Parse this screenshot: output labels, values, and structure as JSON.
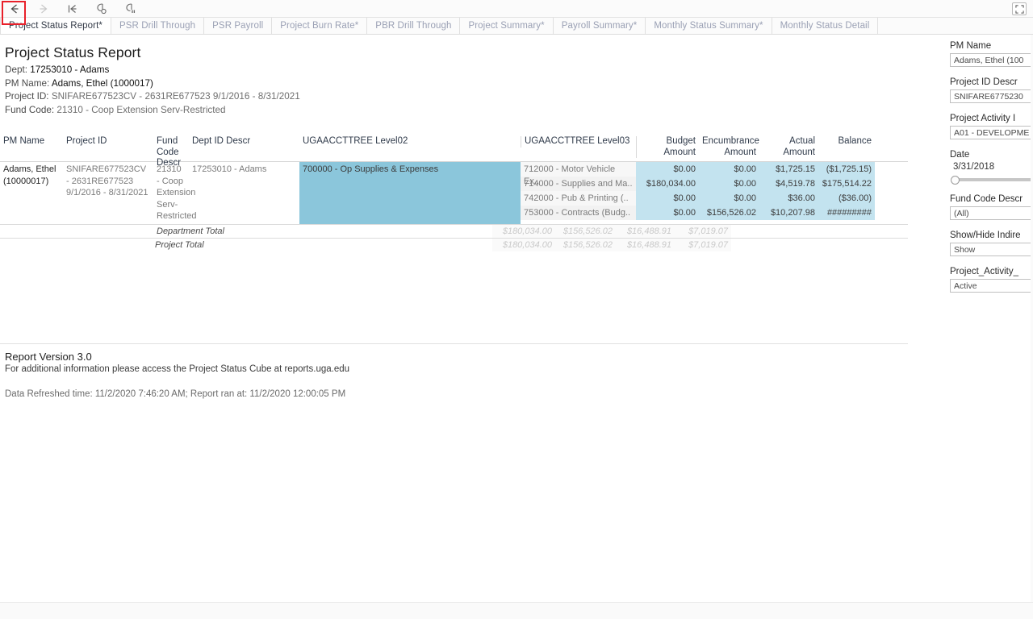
{
  "toolbar": {
    "back": "back-arrow",
    "forward": "forward-arrow",
    "revert": "revert-to-start",
    "refresh": "refresh-data",
    "pause": "pause-auto-updates",
    "fullscreen": "fullscreen-toggle"
  },
  "tabs": [
    {
      "label": "Project Status Report*",
      "active": true
    },
    {
      "label": "PSR Drill Through",
      "active": false
    },
    {
      "label": "PSR Payroll",
      "active": false
    },
    {
      "label": "Project Burn Rate*",
      "active": false
    },
    {
      "label": "PBR Drill Through",
      "active": false
    },
    {
      "label": "Project Summary*",
      "active": false
    },
    {
      "label": "Payroll Summary*",
      "active": false
    },
    {
      "label": "Monthly Status Summary*",
      "active": false
    },
    {
      "label": "Monthly Status Detail",
      "active": false
    }
  ],
  "report": {
    "title": "Project Status Report",
    "dept_label": "Dept:",
    "dept_value": "17253010 - Adams",
    "pm_label": "PM Name:",
    "pm_value": "Adams, Ethel (1000017)",
    "project_label": "Project ID:",
    "project_value": "SNIFARE677523CV - 2631RE677523 9/1/2016 - 8/31/2021",
    "fund_label": "Fund Code:",
    "fund_value": "21310 - Coop Extension Serv-Restricted"
  },
  "table": {
    "headers": {
      "pm_name": "PM Name",
      "project_id": "Project ID",
      "fund_code_descr": "Fund Code Descr",
      "dept_id_descr": "Dept ID Descr",
      "level02": "UGAACCTTREE Level02",
      "level03": "UGAACCTTREE Level03",
      "budget": "Budget Amount",
      "encumbrance": "Encumbrance Amount",
      "actual": "Actual Amount",
      "balance": "Balance"
    },
    "row": {
      "pm_name": "Adams, Ethel (10000017)",
      "project_id": "SNIFARE677523CV - 2631RE677523 9/1/2016 - 8/31/2021",
      "fund_code_descr": "21310 - Coop Extension Serv-Restricted",
      "dept_id_descr": "17253010 - Adams",
      "level02": "700000 - Op Supplies & Expenses"
    },
    "lines": [
      {
        "level03": "712000 - Motor Vehicle Ex..",
        "budget": "$0.00",
        "encumbrance": "$0.00",
        "actual": "$1,725.15",
        "balance": "($1,725.15)"
      },
      {
        "level03": "714000 - Supplies and Ma..",
        "budget": "$180,034.00",
        "encumbrance": "$0.00",
        "actual": "$4,519.78",
        "balance": "$175,514.22"
      },
      {
        "level03": "742000 - Pub & Printing (..",
        "budget": "$0.00",
        "encumbrance": "$0.00",
        "actual": "$36.00",
        "balance": "($36.00)"
      },
      {
        "level03": "753000 - Contracts (Budg..",
        "budget": "$0.00",
        "encumbrance": "$156,526.02",
        "actual": "$10,207.98",
        "balance": "#########"
      }
    ],
    "department_total": {
      "label": "Department Total",
      "budget": "$180,034.00",
      "encumbrance": "$156,526.02",
      "actual": "$16,488.91",
      "balance": "$7,019.07"
    },
    "project_total": {
      "label": "Project Total",
      "budget": "$180,034.00",
      "encumbrance": "$156,526.02",
      "actual": "$16,488.91",
      "balance": "$7,019.07"
    }
  },
  "footer": {
    "version": "Report Version 3.0",
    "info": "For additional information please access the Project Status Cube at reports.uga.edu",
    "refreshed": "Data Refreshed time: 11/2/2020 7:46:20 AM; Report ran at: 11/2/2020 12:00:05 PM"
  },
  "filters": [
    {
      "label": "PM Name",
      "value": "Adams, Ethel (100"
    },
    {
      "label": "Project ID Descr",
      "value": "SNIFARE6775230"
    },
    {
      "label": "Project Activity I",
      "value": "A01 - DEVELOPME"
    }
  ],
  "date_filter": {
    "label": "Date",
    "value": "3/31/2018"
  },
  "filters2": [
    {
      "label": "Fund Code Descr",
      "value": "(All)"
    },
    {
      "label": "Show/Hide Indire",
      "value": "Show"
    },
    {
      "label": "Project_Activity_",
      "value": "Active"
    }
  ],
  "colors": {
    "highlight_dark": "#8bc6db",
    "highlight_light": "#c3e3ef",
    "focus_outline": "#e8202a",
    "tab_inactive": "#9aa0b4"
  }
}
